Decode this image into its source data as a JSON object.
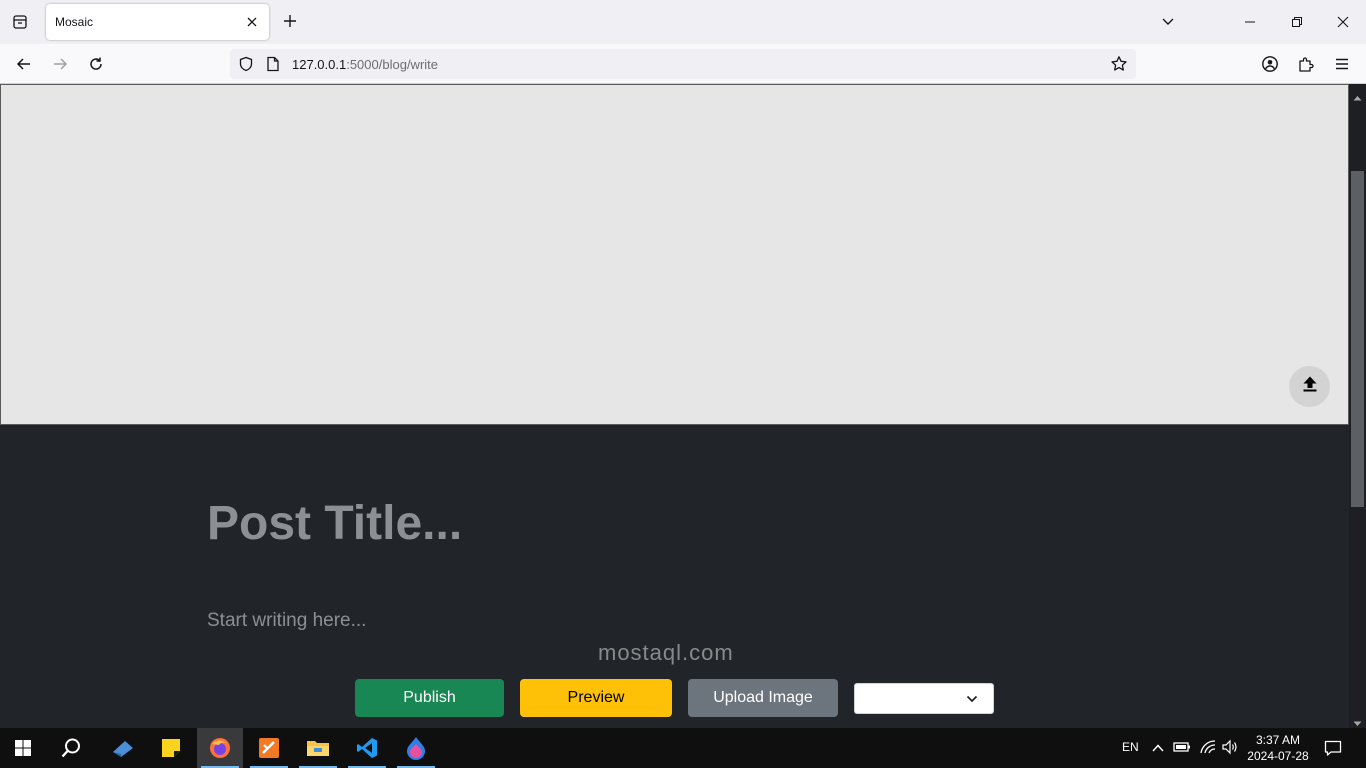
{
  "browser": {
    "tab": {
      "title": "Mosaic"
    },
    "url": {
      "host": "127.0.0.1",
      "path": ":5000/blog/write"
    }
  },
  "editor": {
    "title_placeholder": "Post Title...",
    "body_placeholder": "Start writing here...",
    "buttons": {
      "publish": "Publish",
      "preview": "Preview",
      "upload_image": "Upload Image"
    },
    "category_selected": ""
  },
  "watermark": "mostaql.com",
  "taskbar": {
    "language": "EN",
    "time": "3:37 AM",
    "date": "2024-07-28"
  },
  "colors": {
    "publish": "#198754",
    "preview": "#ffc107",
    "upload": "#6c757d",
    "page_bg": "#212529",
    "cover_bg": "#e6e6e6"
  },
  "icons": {
    "tab_list": "tab-list-icon",
    "close": "close-icon",
    "new_tab": "plus-icon",
    "back": "back-arrow-icon",
    "forward": "forward-arrow-icon",
    "reload": "reload-icon",
    "shield": "shield-icon",
    "page": "page-icon",
    "bookmark": "star-icon",
    "account": "account-icon",
    "extensions": "puzzle-icon",
    "menu": "hamburger-menu-icon",
    "upload_cover": "upload-arrow-icon"
  }
}
